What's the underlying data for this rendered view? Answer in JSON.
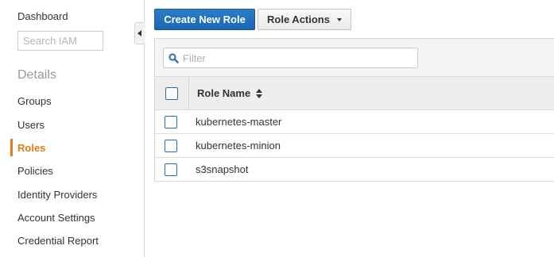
{
  "sidebar": {
    "dashboard": "Dashboard",
    "search_placeholder": "Search IAM",
    "section_heading": "Details",
    "items": [
      {
        "label": "Groups",
        "active": false
      },
      {
        "label": "Users",
        "active": false
      },
      {
        "label": "Roles",
        "active": true
      },
      {
        "label": "Policies",
        "active": false
      },
      {
        "label": "Identity Providers",
        "active": false
      },
      {
        "label": "Account Settings",
        "active": false
      },
      {
        "label": "Credential Report",
        "active": false
      }
    ],
    "collapse_icon": "chevron-left-icon"
  },
  "toolbar": {
    "create_label": "Create New Role",
    "actions_label": "Role Actions"
  },
  "filter": {
    "placeholder": "Filter",
    "icon": "search-icon"
  },
  "table": {
    "column_header": "Role Name",
    "rows": [
      {
        "name": "kubernetes-master"
      },
      {
        "name": "kubernetes-minion"
      },
      {
        "name": "s3snapshot"
      }
    ]
  },
  "colors": {
    "accent": "#e47911",
    "primary_button": "#1a66b2",
    "checkbox_border": "#2b6ea9"
  }
}
